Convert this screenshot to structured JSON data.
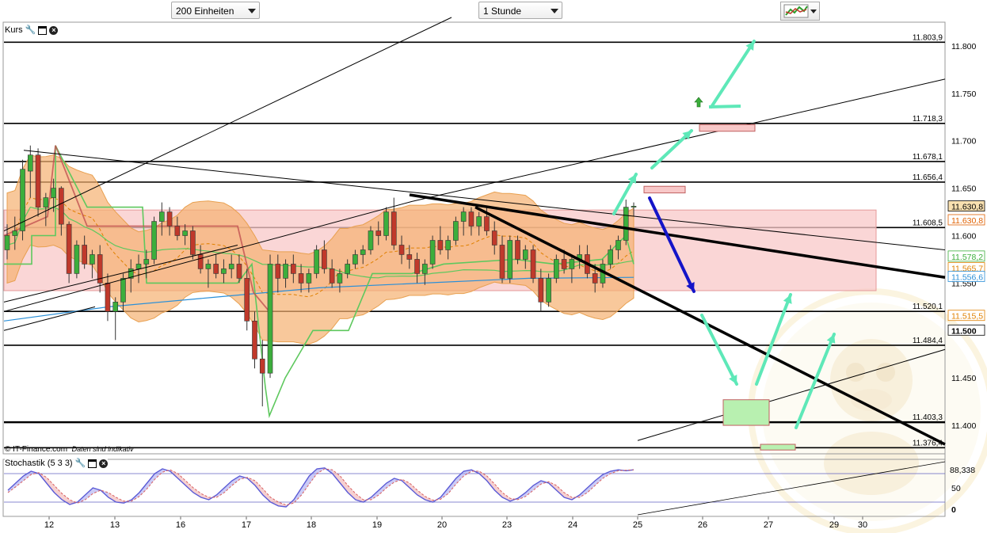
{
  "toolbar": {
    "range_select": "200 Einheiten",
    "interval_select": "1 Stunde"
  },
  "main_panel": {
    "label": "Kurs"
  },
  "stoch_panel": {
    "label": "Stochastik (5 3 3)"
  },
  "credit": {
    "brand": "© IT-Finance.com",
    "note": "Daten sind indikativ"
  },
  "icons": [
    "chevron-down-icon",
    "chart-tools-icon",
    "wrench-icon",
    "window-icon",
    "close-icon",
    "up-arrow-icon",
    "monkey-watermark-icon"
  ],
  "colors": {
    "candle_up": "#3cae3c",
    "candle_down": "#c0392b",
    "band_fill": "#f5b070",
    "zone_fill": "#f8c8c8",
    "arrow_teal": "#5ee8b8",
    "arrow_blue": "#1414c8",
    "ma_blue": "#2a8fd8",
    "ma_green": "#5ec85e",
    "stoch_k": "#5b5bd6",
    "stoch_d": "#d86060"
  },
  "chart_data": {
    "type": "candlestick",
    "ylim": [
      11.37,
      11.825
    ],
    "y_ticks": [
      "11.800",
      "11.750",
      "11.700",
      "11.650",
      "11.600",
      "11.550",
      "11.500",
      "11.450",
      "11.400"
    ],
    "x_ticks": [
      "12",
      "13",
      "16",
      "17",
      "18",
      "19",
      "20",
      "23",
      "24",
      "25",
      "26",
      "27",
      "29",
      "30"
    ],
    "levels": [
      {
        "label": "11.803,9",
        "value": 11.8039
      },
      {
        "label": "11.718,3",
        "value": 11.7183
      },
      {
        "label": "11.678,1",
        "value": 11.6781
      },
      {
        "label": "11.656,4",
        "value": 11.6564
      },
      {
        "label": "11.608,5",
        "value": 11.6085
      },
      {
        "label": "11.520,1",
        "value": 11.5201
      },
      {
        "label": "11.484,4",
        "value": 11.4844
      },
      {
        "label": "11.403,3",
        "value": 11.4033
      },
      {
        "label": "11.376,4",
        "value": 11.3764
      }
    ],
    "right_tags": [
      {
        "label": "11.630,8",
        "value": 11.6308,
        "color": "#000000",
        "bg": "#f8e0b0"
      },
      {
        "label": "11.630,8",
        "value": 11.6163,
        "color": "#e06000",
        "bg": "#ffffff"
      },
      {
        "label": "11.578,2",
        "value": 11.578,
        "color": "#3cae3c",
        "bg": "#ffffff"
      },
      {
        "label": "11.565,7",
        "value": 11.5657,
        "color": "#e08000",
        "bg": "#ffffff"
      },
      {
        "label": "11.556,6",
        "value": 11.5566,
        "color": "#2a8fd8",
        "bg": "#ffffff"
      },
      {
        "label": "11.515,5",
        "value": 11.5155,
        "color": "#e08000",
        "bg": "#ffffff"
      },
      {
        "label": "11.500",
        "value": 11.5,
        "color": "#000000",
        "bg": "#ffffff"
      }
    ],
    "candles": [
      [
        11.585,
        11.612,
        11.575,
        11.6
      ],
      [
        11.6,
        11.62,
        11.585,
        11.605
      ],
      [
        11.605,
        11.68,
        11.595,
        11.67
      ],
      [
        11.668,
        11.695,
        11.64,
        11.685
      ],
      [
        11.685,
        11.692,
        11.62,
        11.63
      ],
      [
        11.63,
        11.645,
        11.61,
        11.64
      ],
      [
        11.64,
        11.66,
        11.625,
        11.65
      ],
      [
        11.65,
        11.652,
        11.6,
        11.612
      ],
      [
        11.612,
        11.615,
        11.55,
        11.56
      ],
      [
        11.56,
        11.595,
        11.555,
        11.59
      ],
      [
        11.59,
        11.6,
        11.565,
        11.57
      ],
      [
        11.57,
        11.585,
        11.555,
        11.58
      ],
      [
        11.58,
        11.59,
        11.54,
        11.55
      ],
      [
        11.55,
        11.56,
        11.51,
        11.52
      ],
      [
        11.52,
        11.535,
        11.49,
        11.53
      ],
      [
        11.53,
        11.56,
        11.52,
        11.555
      ],
      [
        11.555,
        11.575,
        11.54,
        11.565
      ],
      [
        11.565,
        11.58,
        11.55,
        11.57
      ],
      [
        11.57,
        11.585,
        11.555,
        11.575
      ],
      [
        11.575,
        11.62,
        11.57,
        11.615
      ],
      [
        11.615,
        11.635,
        11.6,
        11.625
      ],
      [
        11.625,
        11.63,
        11.6,
        11.61
      ],
      [
        11.61,
        11.62,
        11.595,
        11.6
      ],
      [
        11.6,
        11.612,
        11.59,
        11.605
      ],
      [
        11.605,
        11.61,
        11.575,
        11.58
      ],
      [
        11.58,
        11.59,
        11.56,
        11.565
      ],
      [
        11.565,
        11.575,
        11.545,
        11.57
      ],
      [
        11.57,
        11.58,
        11.555,
        11.56
      ],
      [
        11.56,
        11.575,
        11.55,
        11.565
      ],
      [
        11.565,
        11.58,
        11.555,
        11.57
      ],
      [
        11.57,
        11.58,
        11.55,
        11.555
      ],
      [
        11.555,
        11.565,
        11.5,
        11.51
      ],
      [
        11.51,
        11.52,
        11.46,
        11.47
      ],
      [
        11.47,
        11.49,
        11.42,
        11.455
      ],
      [
        11.455,
        11.58,
        11.45,
        11.57
      ],
      [
        11.57,
        11.58,
        11.54,
        11.555
      ],
      [
        11.555,
        11.575,
        11.545,
        11.57
      ],
      [
        11.57,
        11.58,
        11.55,
        11.56
      ],
      [
        11.56,
        11.57,
        11.54,
        11.55
      ],
      [
        11.55,
        11.565,
        11.54,
        11.56
      ],
      [
        11.56,
        11.59,
        11.555,
        11.585
      ],
      [
        11.585,
        11.595,
        11.56,
        11.565
      ],
      [
        11.565,
        11.575,
        11.545,
        11.55
      ],
      [
        11.55,
        11.565,
        11.54,
        11.56
      ],
      [
        11.56,
        11.575,
        11.555,
        11.57
      ],
      [
        11.57,
        11.585,
        11.565,
        11.58
      ],
      [
        11.58,
        11.59,
        11.57,
        11.585
      ],
      [
        11.585,
        11.61,
        11.58,
        11.605
      ],
      [
        11.605,
        11.615,
        11.59,
        11.6
      ],
      [
        11.6,
        11.63,
        11.595,
        11.625
      ],
      [
        11.625,
        11.64,
        11.585,
        11.59
      ],
      [
        11.59,
        11.6,
        11.57,
        11.58
      ],
      [
        11.58,
        11.59,
        11.565,
        11.575
      ],
      [
        11.575,
        11.582,
        11.55,
        11.56
      ],
      [
        11.56,
        11.575,
        11.548,
        11.57
      ],
      [
        11.57,
        11.6,
        11.565,
        11.595
      ],
      [
        11.595,
        11.61,
        11.58,
        11.585
      ],
      [
        11.585,
        11.6,
        11.575,
        11.595
      ],
      [
        11.595,
        11.62,
        11.59,
        11.615
      ],
      [
        11.615,
        11.63,
        11.6,
        11.625
      ],
      [
        11.625,
        11.63,
        11.6,
        11.61
      ],
      [
        11.61,
        11.625,
        11.6,
        11.62
      ],
      [
        11.62,
        11.63,
        11.6,
        11.605
      ],
      [
        11.605,
        11.615,
        11.58,
        11.59
      ],
      [
        11.59,
        11.6,
        11.55,
        11.555
      ],
      [
        11.555,
        11.6,
        11.55,
        11.595
      ],
      [
        11.595,
        11.6,
        11.57,
        11.575
      ],
      [
        11.575,
        11.59,
        11.565,
        11.585
      ],
      [
        11.585,
        11.59,
        11.55,
        11.555
      ],
      [
        11.555,
        11.565,
        11.52,
        11.53
      ],
      [
        11.53,
        11.56,
        11.525,
        11.555
      ],
      [
        11.555,
        11.58,
        11.55,
        11.575
      ],
      [
        11.575,
        11.585,
        11.56,
        11.565
      ],
      [
        11.565,
        11.58,
        11.55,
        11.575
      ],
      [
        11.575,
        11.59,
        11.565,
        11.58
      ],
      [
        11.58,
        11.59,
        11.555,
        11.56
      ],
      [
        11.56,
        11.57,
        11.54,
        11.55
      ],
      [
        11.55,
        11.575,
        11.545,
        11.57
      ],
      [
        11.57,
        11.59,
        11.565,
        11.585
      ],
      [
        11.585,
        11.6,
        11.575,
        11.595
      ],
      [
        11.595,
        11.638,
        11.59,
        11.63
      ],
      [
        11.63,
        11.635,
        11.62,
        11.631
      ]
    ],
    "stochastic": {
      "ylim": [
        0,
        100
      ],
      "y_ticks": [
        "50",
        "0"
      ],
      "last_label": "88,338",
      "last_value": 88.338,
      "k": [
        45,
        60,
        75,
        85,
        80,
        60,
        40,
        25,
        15,
        20,
        35,
        50,
        45,
        30,
        20,
        18,
        25,
        40,
        60,
        80,
        90,
        85,
        70,
        55,
        40,
        30,
        25,
        35,
        50,
        65,
        75,
        70,
        55,
        35,
        20,
        12,
        10,
        25,
        50,
        75,
        90,
        92,
        80,
        60,
        40,
        25,
        20,
        30,
        45,
        60,
        70,
        65,
        50,
        35,
        25,
        20,
        30,
        50,
        70,
        85,
        88,
        80,
        65,
        45,
        30,
        22,
        28,
        40,
        55,
        65,
        60,
        45,
        30,
        25,
        35,
        50,
        65,
        78,
        85,
        88,
        86,
        88
      ],
      "d": [
        40,
        52,
        65,
        78,
        82,
        72,
        55,
        38,
        25,
        18,
        25,
        38,
        45,
        40,
        30,
        22,
        22,
        32,
        48,
        68,
        83,
        88,
        80,
        65,
        50,
        38,
        30,
        30,
        40,
        55,
        68,
        72,
        65,
        48,
        30,
        20,
        14,
        18,
        35,
        58,
        80,
        90,
        88,
        75,
        55,
        38,
        25,
        25,
        35,
        50,
        62,
        68,
        60,
        45,
        32,
        24,
        26,
        38,
        58,
        75,
        85,
        85,
        75,
        58,
        40,
        28,
        25,
        32,
        45,
        58,
        63,
        55,
        40,
        30,
        30,
        40,
        55,
        70,
        80,
        86,
        87,
        88
      ]
    }
  }
}
